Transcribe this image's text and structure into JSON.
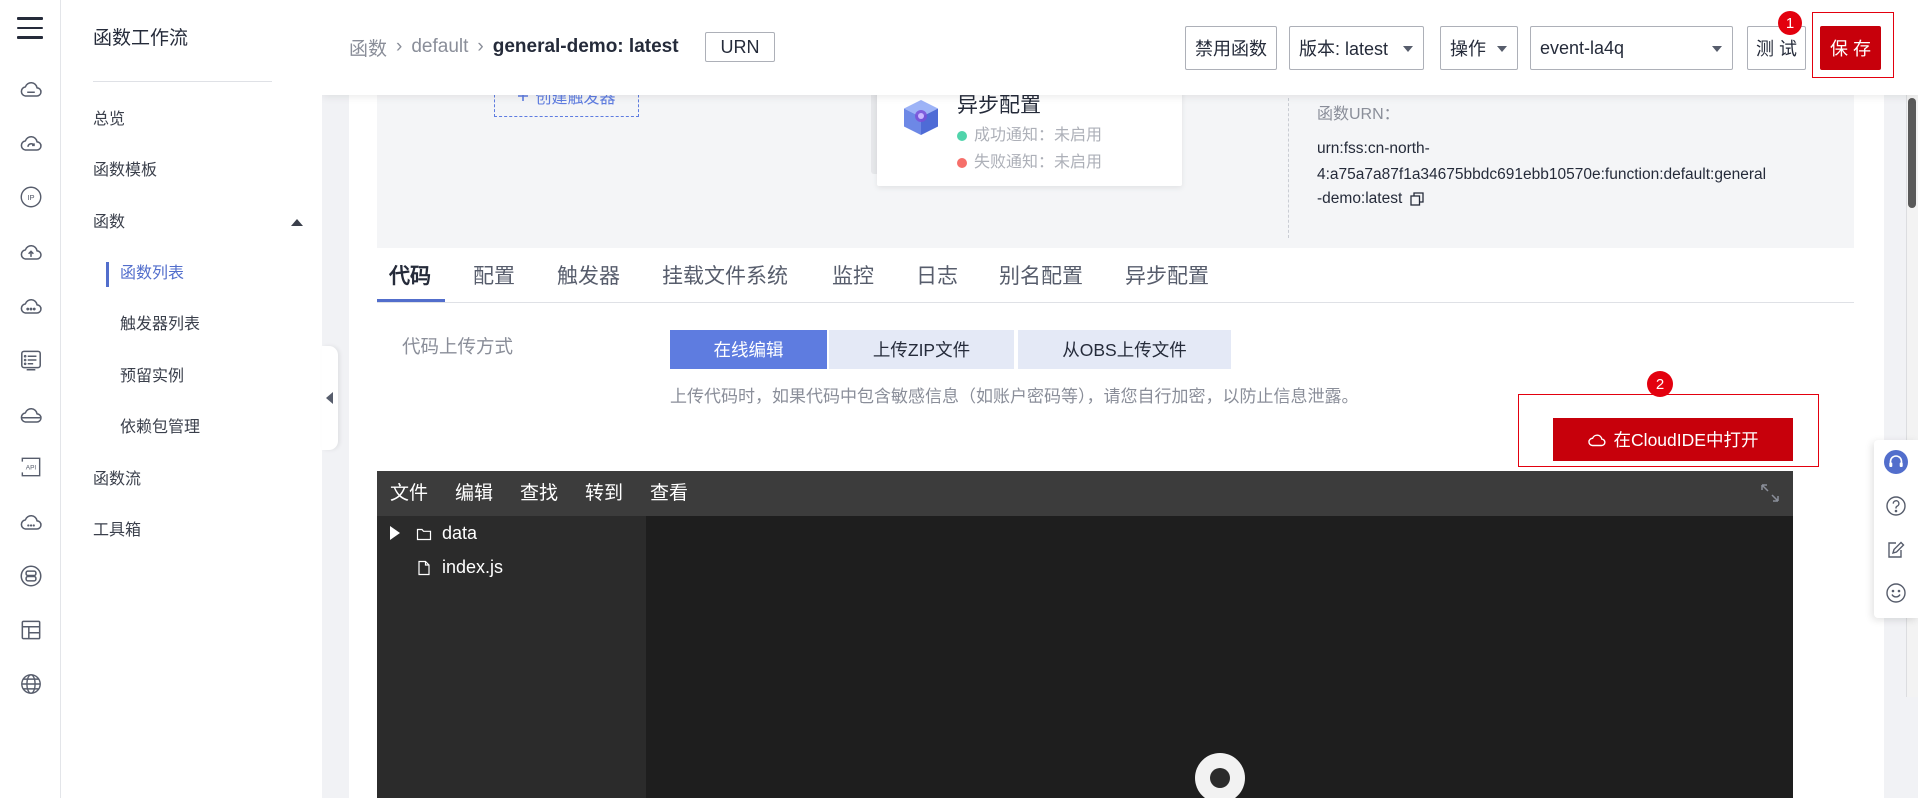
{
  "rail": {
    "icons": [
      "menu-icon",
      "cloud-storage-icon",
      "cloud-sync-icon",
      "ip-icon",
      "cloud-upload-icon",
      "cloud-service-icon",
      "list-panel-icon",
      "cloud-disk-icon",
      "api-icon",
      "cloud-dots-icon",
      "gear-stack-icon",
      "layout-icon",
      "globe-icon"
    ],
    "ip_text": "IP",
    "api_text": "API"
  },
  "sidebar": {
    "title": "函数工作流",
    "items": [
      {
        "label": "总览"
      },
      {
        "label": "函数模板"
      },
      {
        "label": "函数",
        "expanded": true
      },
      {
        "label": "函数列表",
        "active": true
      },
      {
        "label": "触发器列表"
      },
      {
        "label": "预留实例"
      },
      {
        "label": "依赖包管理"
      },
      {
        "label": "函数流"
      },
      {
        "label": "工具箱"
      }
    ]
  },
  "header": {
    "breadcrumb": [
      "函数",
      "default",
      "general-demo: latest"
    ],
    "separator": "›",
    "urn_button": "URN",
    "disable_button": "禁用函数",
    "version_select": "版本: latest",
    "action_select": "操作",
    "event_select": "event-la4q",
    "test_button": "测 试",
    "save_button": "保 存",
    "step_badge": "1"
  },
  "overview": {
    "create_trigger": "创建触发器",
    "async_card": {
      "title": "异步配置",
      "success": "成功通知：未启用",
      "failure": "失败通知：未启用"
    },
    "urn_label": "函数URN：",
    "urn_lines": [
      "urn:fss:cn-north-",
      "4:a75a7a87f1a34675bbdc691ebb10570e:function:default:general",
      "-demo:latest"
    ]
  },
  "tabs": [
    {
      "label": "代码",
      "active": true
    },
    {
      "label": "配置"
    },
    {
      "label": "触发器"
    },
    {
      "label": "挂载文件系统"
    },
    {
      "label": "监控"
    },
    {
      "label": "日志"
    },
    {
      "label": "别名配置"
    },
    {
      "label": "异步配置"
    }
  ],
  "code": {
    "upload_label": "代码上传方式",
    "modes": [
      {
        "label": "在线编辑",
        "selected": true
      },
      {
        "label": "上传ZIP文件"
      },
      {
        "label": "从OBS上传文件"
      }
    ],
    "hint": "上传代码时，如果代码中包含敏感信息（如账户密码等），请您自行加密，以防止信息泄露。",
    "cloudide_button": "在CloudIDE中打开",
    "step_badge": "2"
  },
  "editor": {
    "menu": [
      "文件",
      "编辑",
      "查找",
      "转到",
      "查看"
    ],
    "tree": [
      {
        "name": "data",
        "type": "folder",
        "expanded": false
      },
      {
        "name": "index.js",
        "type": "file"
      }
    ]
  },
  "help_toolbar": {
    "icons": [
      "headset-icon",
      "question-icon",
      "feedback-edit-icon",
      "smile-icon"
    ]
  },
  "colors": {
    "accent": "#5e7ce0",
    "active_nav": "#526ecc",
    "primary_red": "#c7000b",
    "highlight_outline": "#e3000e",
    "success_dot": "#50d4ab",
    "failure_dot": "#f66f6a",
    "editor_bg": "#1e1e1e"
  }
}
